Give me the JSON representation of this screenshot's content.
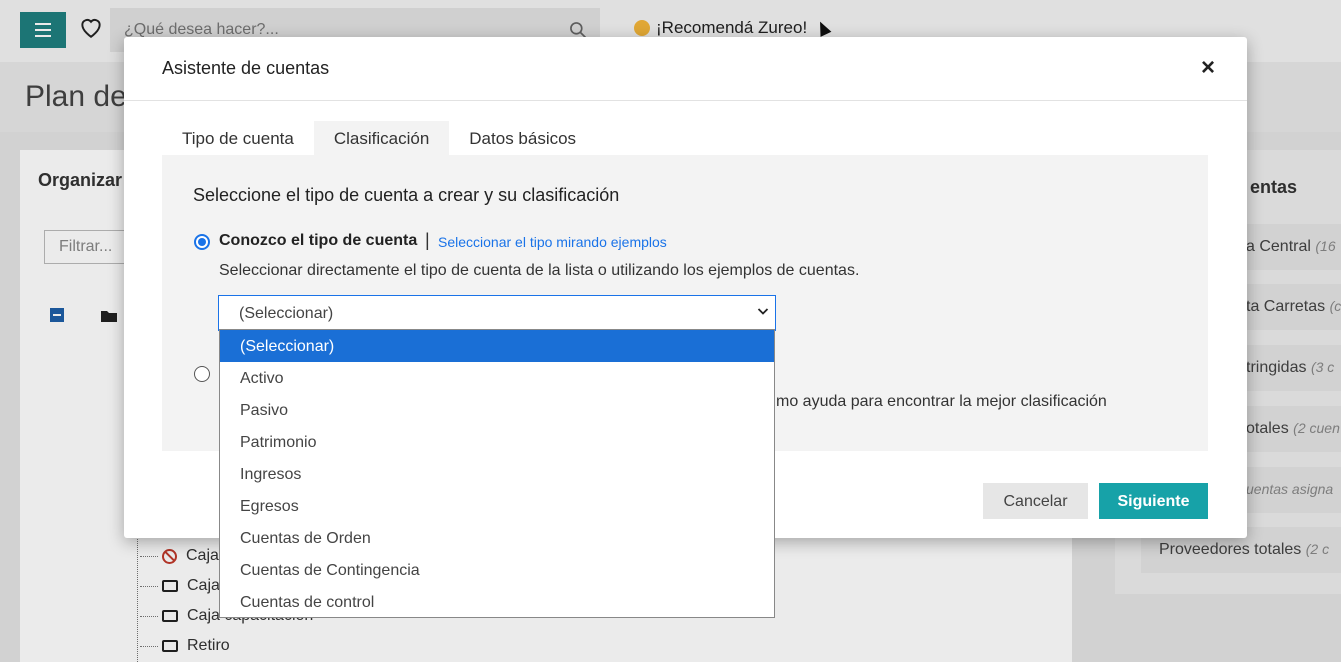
{
  "app": {
    "search_placeholder": "¿Qué desea hacer?...",
    "recommend_label": "¡Recomendá Zureo!",
    "page_title": "Plan de",
    "organize_title": "Organizar",
    "filter_placeholder": "Filtrar...",
    "tree_items": [
      {
        "label": "Caja",
        "icon": "ban-icon"
      },
      {
        "label": "Caja",
        "icon": "folder-icon"
      },
      {
        "label": "Caja capacitación",
        "icon": "folder-icon"
      },
      {
        "label": "Retiro",
        "icon": "folder-icon"
      }
    ],
    "right_panel": {
      "title": "entas",
      "items": [
        {
          "label": "a Central",
          "count": "(16"
        },
        {
          "label": "ta Carretas",
          "count": "(c"
        },
        {
          "label": "tringidas",
          "count": "(3 c"
        },
        {
          "label": "otales",
          "count": "(2 cuen"
        },
        {
          "label": "",
          "count": "uentas asigna"
        },
        {
          "label": "Proveedores totales",
          "count": "(2 c"
        }
      ]
    }
  },
  "modal": {
    "title": "Asistente de cuentas",
    "close_label": "×",
    "tabs": [
      {
        "label": "Tipo de cuenta",
        "active": false
      },
      {
        "label": "Clasificación",
        "active": true
      },
      {
        "label": "Datos básicos",
        "active": false
      }
    ],
    "section_title": "Seleccione el tipo de cuenta a crear y su clasificación",
    "option1": {
      "label": "Conozco el tipo de cuenta",
      "separator": "|",
      "link": "Seleccionar el tipo mirando ejemplos",
      "description": "Seleccionar directamente el tipo de cuenta de la lista o utilizando los ejemplos de cuentas."
    },
    "option2": {
      "tail_text": "mo ayuda para encontrar la mejor clasificación"
    },
    "select": {
      "value": "(Seleccionar)",
      "options": [
        "(Seleccionar)",
        "Activo",
        "Pasivo",
        "Patrimonio",
        "Ingresos",
        "Egresos",
        "Cuentas de Orden",
        "Cuentas de Contingencia",
        "Cuentas de control"
      ],
      "selected_index": 0
    },
    "buttons": {
      "cancel": "Cancelar",
      "next": "Siguiente"
    }
  },
  "colors": {
    "accent": "#17a2a8",
    "link": "#1a73e8",
    "selected_option": "#1a6fd6",
    "menu_button": "#1f7f7f"
  }
}
